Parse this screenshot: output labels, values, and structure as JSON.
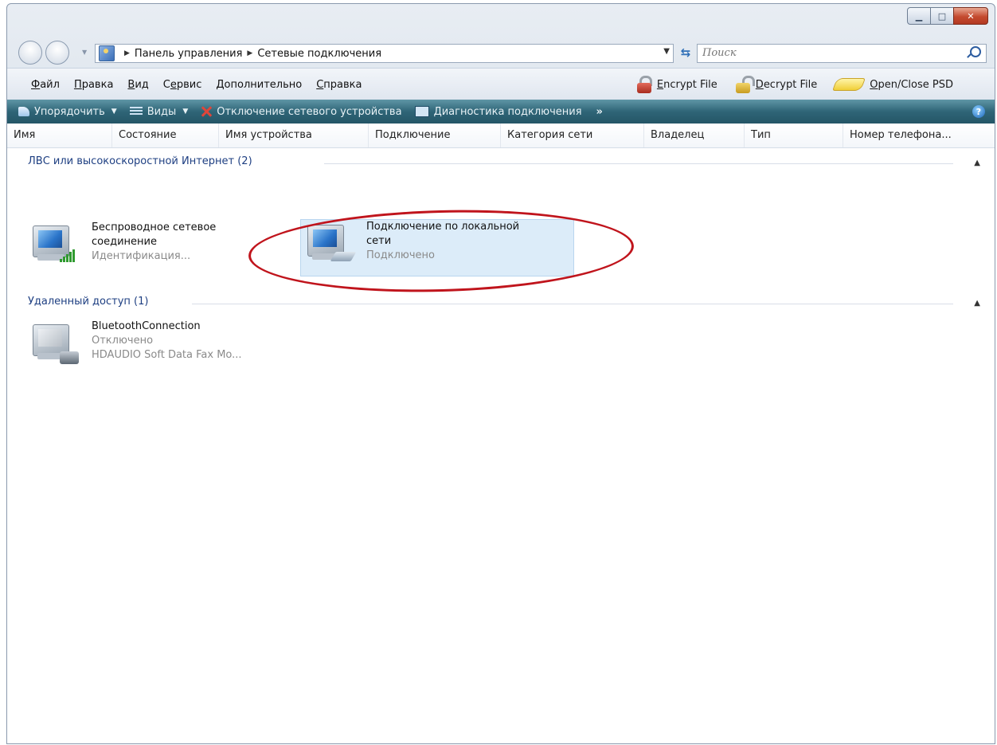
{
  "window": {
    "controls": {
      "minimize_icon": "minimize-icon",
      "maximize_icon": "maximize-icon",
      "close_icon": "close-icon"
    }
  },
  "address_bar": {
    "breadcrumbs": [
      "Панель управления",
      "Сетевые подключения"
    ],
    "search_placeholder": "Поиск"
  },
  "menu": {
    "items": [
      {
        "mnemonic": "Ф",
        "rest": "айл"
      },
      {
        "mnemonic": "П",
        "rest": "равка"
      },
      {
        "mnemonic": "В",
        "rest": "ид"
      },
      {
        "pre": "С",
        "mnemonic": "е",
        "rest": "рвис"
      },
      {
        "mnemonic": "Д",
        "rest": "ополнительно"
      },
      {
        "mnemonic": "С",
        "rest": "правка"
      }
    ],
    "tools": [
      {
        "mnemonic": "E",
        "rest": "ncrypt File",
        "icon": "encrypt-lock-icon"
      },
      {
        "mnemonic": "D",
        "rest": "ecrypt File",
        "icon": "decrypt-lock-icon"
      },
      {
        "mnemonic": "O",
        "rest": "pen/Close PSD",
        "icon": "psd-icon"
      }
    ]
  },
  "toolbar": {
    "organize": "Упорядочить",
    "views": "Виды",
    "disable": "Отключение сетевого устройства",
    "diagnose": "Диагностика подключения",
    "more": "»"
  },
  "columns": [
    "Имя",
    "Состояние",
    "Имя устройства",
    "Подключение",
    "Категория сети",
    "Владелец",
    "Тип",
    "Номер телефона..."
  ],
  "groups": [
    {
      "title": "ЛВС или высокоскоростной Интернет (2)",
      "items": [
        {
          "name_line1": "Беспроводное сетевое",
          "name_line2": "соединение",
          "status": "Идентификация..."
        },
        {
          "name_line1": "Подключение по локальной",
          "name_line2": "сети",
          "status": "Подключено"
        }
      ]
    },
    {
      "title": "Удаленный доступ (1)",
      "items": [
        {
          "name_line1": "BluetoothConnection",
          "status": "Отключено",
          "device": "HDAUDIO Soft Data Fax Mo..."
        }
      ]
    }
  ],
  "colors": {
    "toolbar": "#2f6577",
    "highlight_ellipse": "#c0141c",
    "group_title": "#1e3f82",
    "selection": "#dcecf9"
  }
}
